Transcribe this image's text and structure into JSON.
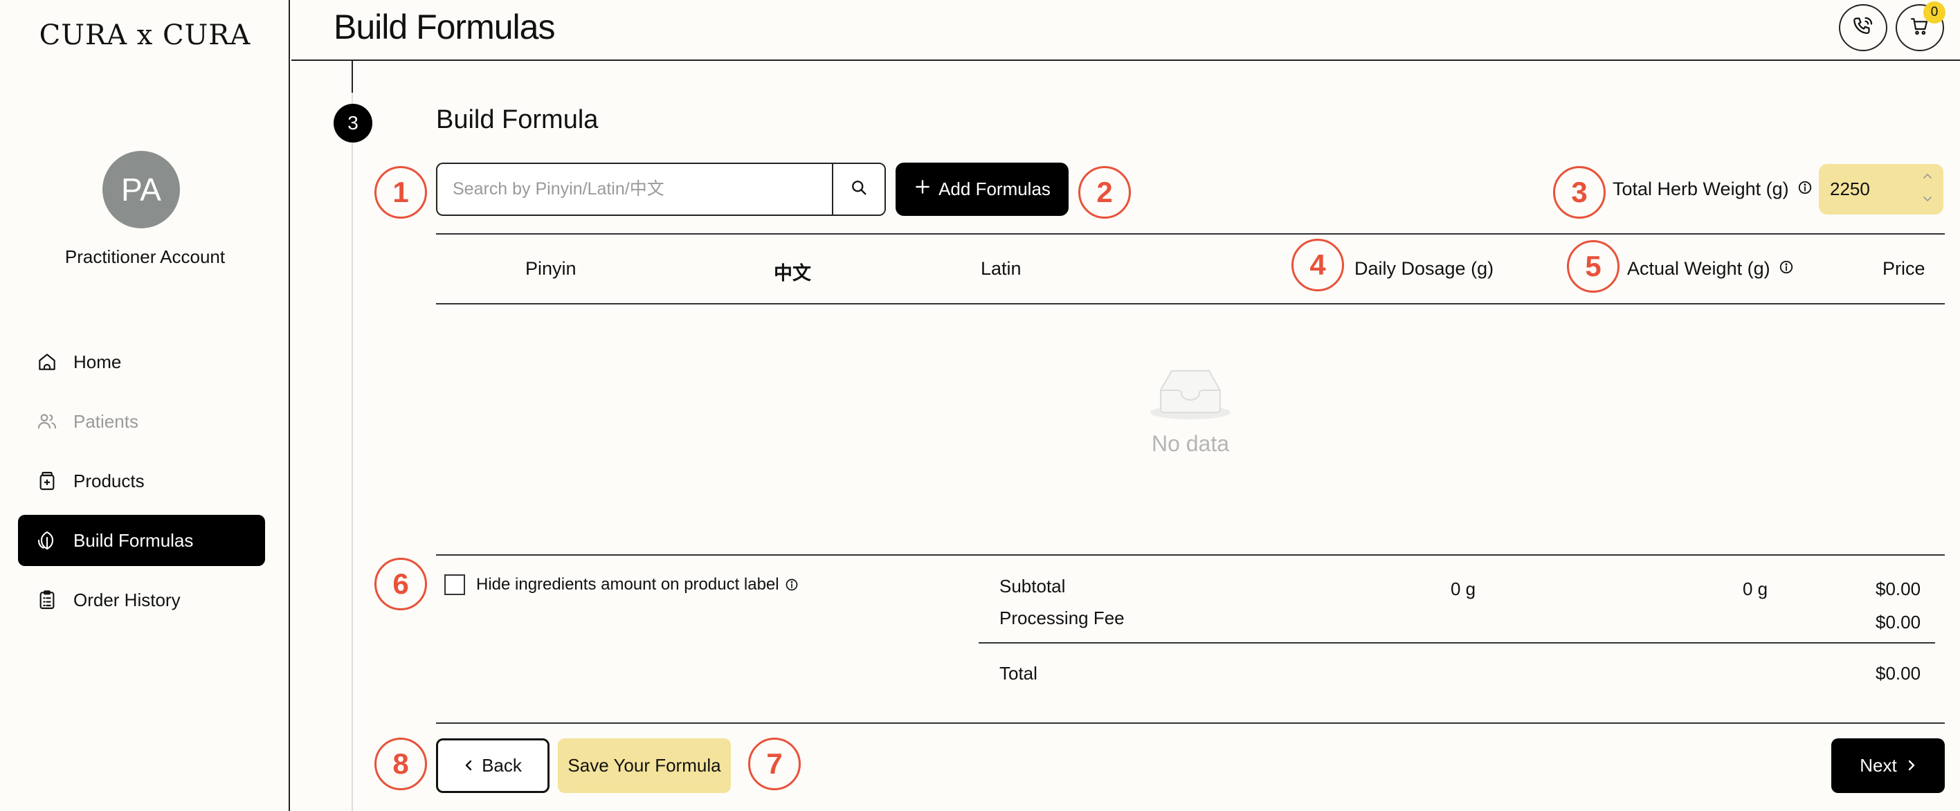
{
  "app": {
    "logo": "CURA x CURA"
  },
  "sidebar": {
    "avatar_initials": "PA",
    "account_label": "Practitioner Account",
    "items": [
      {
        "label": "Home",
        "icon": "home-icon",
        "state": "normal"
      },
      {
        "label": "Patients",
        "icon": "users-icon",
        "state": "disabled"
      },
      {
        "label": "Products",
        "icon": "bottle-icon",
        "state": "normal"
      },
      {
        "label": "Build Formulas",
        "icon": "leaf-icon",
        "state": "active"
      },
      {
        "label": "Order History",
        "icon": "clipboard-icon",
        "state": "normal"
      }
    ]
  },
  "header": {
    "title": "Build Formulas",
    "cart_count": "0"
  },
  "step": {
    "number": "3",
    "title": "Build Formula"
  },
  "markers": [
    "1",
    "2",
    "3",
    "4",
    "5",
    "6",
    "7",
    "8"
  ],
  "search": {
    "placeholder": "Search by Pinyin/Latin/中文",
    "value": ""
  },
  "add_button": {
    "label": "Add Formulas"
  },
  "weight": {
    "label": "Total Herb Weight (g)",
    "value": "2250"
  },
  "table": {
    "columns": {
      "pinyin": "Pinyin",
      "chinese": "中文",
      "latin": "Latin",
      "daily_dosage": "Daily Dosage (g)",
      "actual_weight": "Actual Weight (g)",
      "price": "Price"
    },
    "empty_text": "No data"
  },
  "options": {
    "hide_ingredients_label": "Hide ingredients amount on product label"
  },
  "summary": {
    "subtotal_label": "Subtotal",
    "subtotal_daily": "0 g",
    "subtotal_actual": "0 g",
    "subtotal_price": "$0.00",
    "processing_label": "Processing Fee",
    "processing_price": "$0.00",
    "total_label": "Total",
    "total_price": "$0.00"
  },
  "footer": {
    "back_label": "Back",
    "save_label": "Save Your Formula",
    "next_label": "Next"
  },
  "colors": {
    "marker": "#e8523a",
    "accent_yellow": "#f4e39c",
    "badge_yellow": "#f6d22a",
    "primary": "#000000",
    "background": "#fdfcf8"
  }
}
